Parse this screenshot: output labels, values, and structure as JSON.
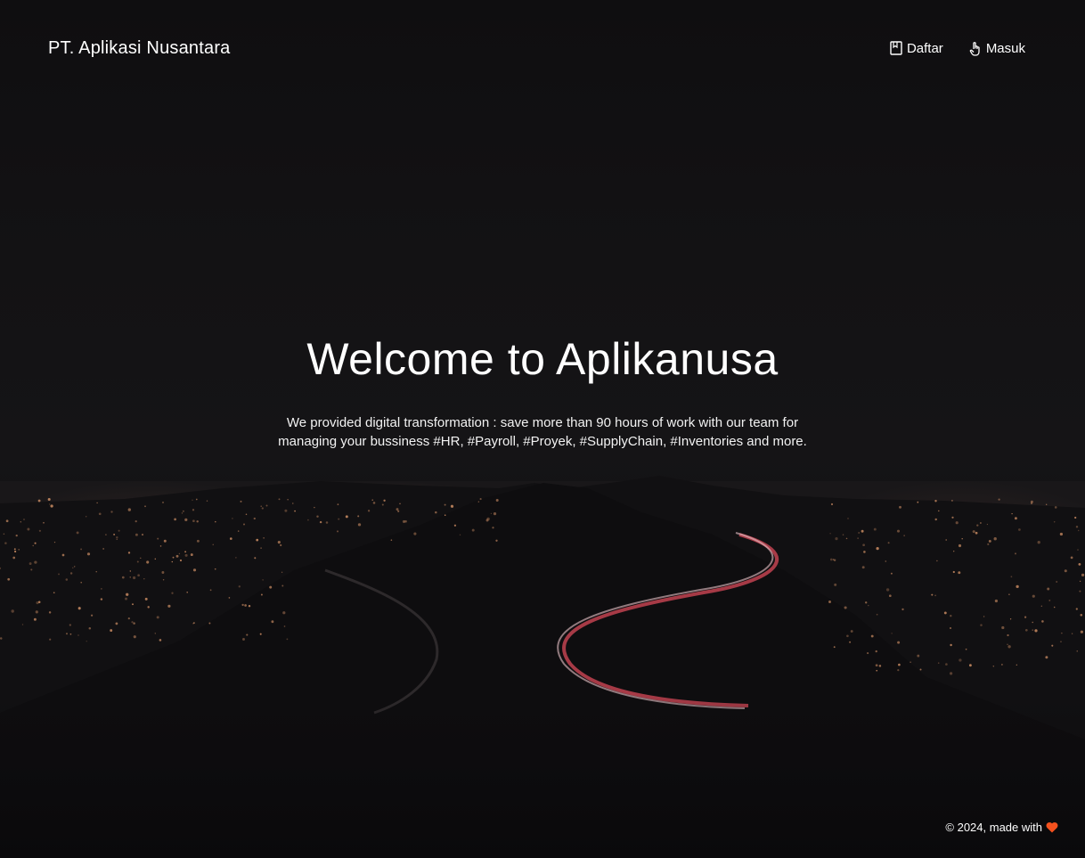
{
  "header": {
    "brand": "PT. Aplikasi Nusantara",
    "nav": [
      {
        "label": "Daftar",
        "icon": "book-icon"
      },
      {
        "label": "Masuk",
        "icon": "pointer-hand-icon"
      }
    ]
  },
  "hero": {
    "title": "Welcome to Aplikanusa",
    "description": "We provided digital transformation : save more than 90 hours of work with our team for managing your bussiness #HR, #Payroll, #Proyek, #SupplyChain, #Inventories and more."
  },
  "footer": {
    "text": "© 2024, made with",
    "icon": "heart-icon"
  },
  "colors": {
    "background": "#0b0a0c",
    "text": "#ffffff",
    "heart": "#f4511e",
    "city_lights": "#e8a070",
    "light_trail": "#d94a5a"
  }
}
